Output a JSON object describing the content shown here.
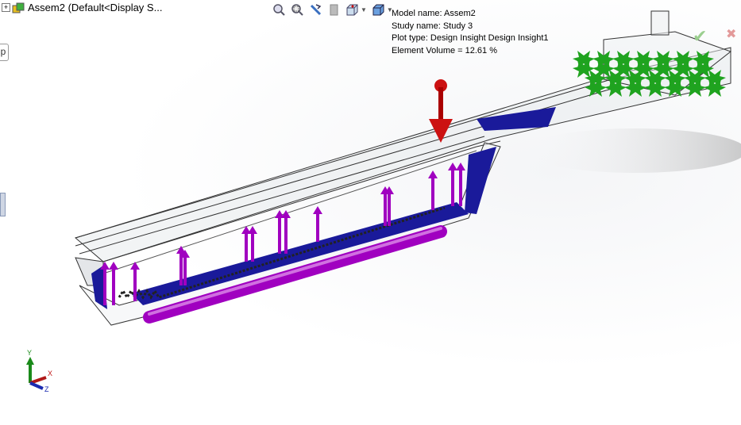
{
  "document": {
    "tree_label": "Assem2  (Default<Display S...",
    "expander": "+",
    "left_tab": "p"
  },
  "toolbar": {
    "items": [
      "zoom-to-fit",
      "zoom-to-area",
      "previous-view",
      "section-view",
      "view-orientation",
      "display-style",
      "hide-show-items",
      "edit-appearance",
      "apply-scene",
      "view-settings"
    ]
  },
  "plot_info": {
    "model_name": "Model name: Assem2",
    "study_name": "Study name: Study 3",
    "plot_type": "Plot type: Design Insight Design Insight1",
    "element_volume": "Element Volume = 12.61 %"
  },
  "triad": {
    "x": "X",
    "y": "Y",
    "z": "Z"
  },
  "confirm": {
    "ok": "✔",
    "cancel": "✖"
  },
  "colors": {
    "load_arrow": "#a000c0",
    "fixture": "#1fa31f",
    "force": "#cc1111",
    "design_insight": "#1a1a9a"
  }
}
